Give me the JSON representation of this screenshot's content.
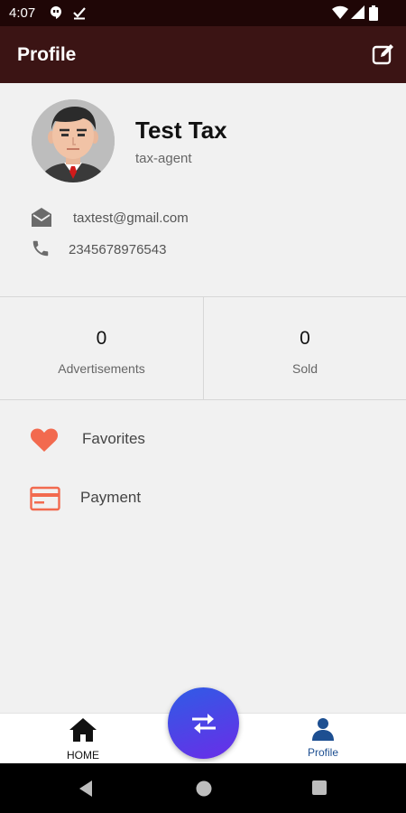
{
  "status_bar": {
    "time": "4:07",
    "icons": [
      "hangouts-icon",
      "check-icon",
      "wifi-icon",
      "signal-icon",
      "battery-icon"
    ]
  },
  "app_bar": {
    "title": "Profile",
    "edit_icon": "edit-icon"
  },
  "profile": {
    "name": "Test Tax",
    "role": "tax-agent",
    "email": "taxtest@gmail.com",
    "phone": "2345678976543"
  },
  "stats": [
    {
      "value": "0",
      "label": "Advertisements"
    },
    {
      "value": "0",
      "label": "Sold"
    }
  ],
  "menu": [
    {
      "label": "Favorites",
      "icon": "heart-icon"
    },
    {
      "label": "Payment",
      "icon": "credit-card-icon"
    }
  ],
  "bottom_nav": {
    "home_label": "HOME",
    "profile_label": "Profile",
    "fab_icon": "swap-arrows-icon"
  },
  "colors": {
    "status_bar": "#1f0606",
    "app_bar": "#3b1414",
    "accent_orange": "#f26a4f",
    "profile_blue": "#1d4f91",
    "fab_start": "#2f5ce5",
    "fab_end": "#6a2de8"
  }
}
